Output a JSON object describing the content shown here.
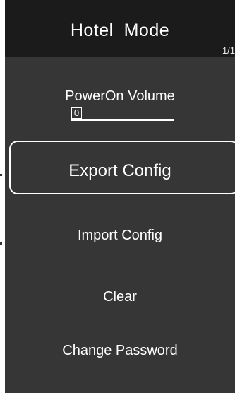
{
  "header": {
    "title": "Hotel  Mode",
    "page_indicator": "1/1"
  },
  "menu": {
    "power_on_volume": {
      "label": "PowerOn Volume",
      "value": "0"
    },
    "selected_item": "Export Config",
    "items": [
      {
        "label": "Import Config"
      },
      {
        "label": "Clear"
      },
      {
        "label": "Change Password"
      }
    ]
  },
  "colors": {
    "screen_background": "#363636",
    "title_bar_background": "#1b1b1b",
    "text": "#ffffff",
    "selection_border": "#ffffff"
  }
}
